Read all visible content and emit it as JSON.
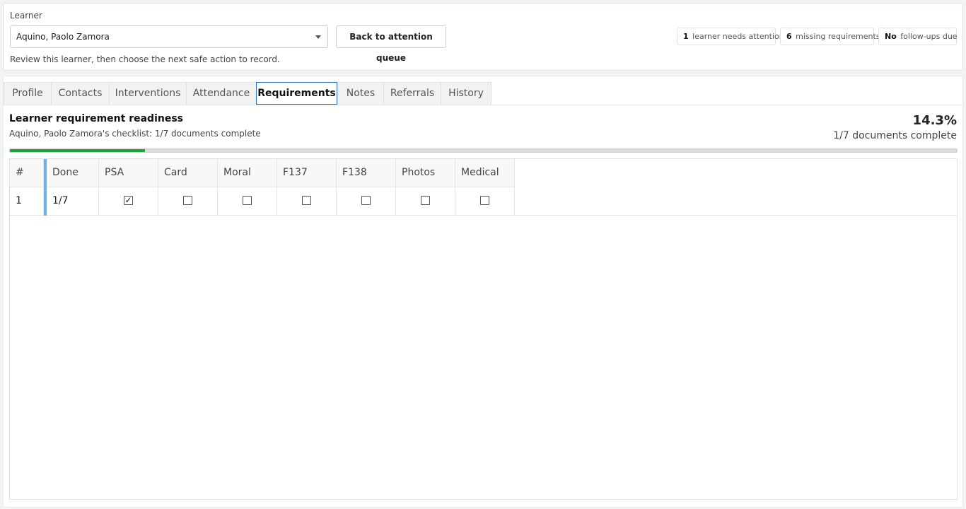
{
  "top": {
    "learner_label": "Learner",
    "learner_value": "Aquino, Paolo Zamora",
    "back_button": "Back to attention queue",
    "hint": "Review this learner, then choose the next safe action to record.",
    "badges": [
      {
        "strong": "1",
        "text": "learner needs attention"
      },
      {
        "strong": "6",
        "text": "missing requirements"
      },
      {
        "strong": "No",
        "text": "follow-ups due"
      }
    ]
  },
  "tabs": [
    "Profile",
    "Contacts",
    "Interventions",
    "Attendance",
    "Requirements",
    "Notes",
    "Referrals",
    "History"
  ],
  "active_tab": "Requirements",
  "requirements": {
    "title": "Learner requirement readiness",
    "subtitle": "Aquino, Paolo Zamora's checklist: 1/7 documents complete",
    "percent": "14.3%",
    "percent_sub": "1/7 documents complete",
    "progress_fraction": 0.143,
    "columns": [
      "#",
      "Done",
      "PSA",
      "Card",
      "Moral",
      "F137",
      "F138",
      "Photos",
      "Medical"
    ],
    "rows": [
      {
        "num": "1",
        "done": "1/7",
        "checks": [
          true,
          false,
          false,
          false,
          false,
          false,
          false
        ]
      }
    ]
  },
  "colors": {
    "progress": "#1ba33a",
    "active_tab_border": "#2b71b8",
    "row_accent": "#6fb2e8"
  }
}
